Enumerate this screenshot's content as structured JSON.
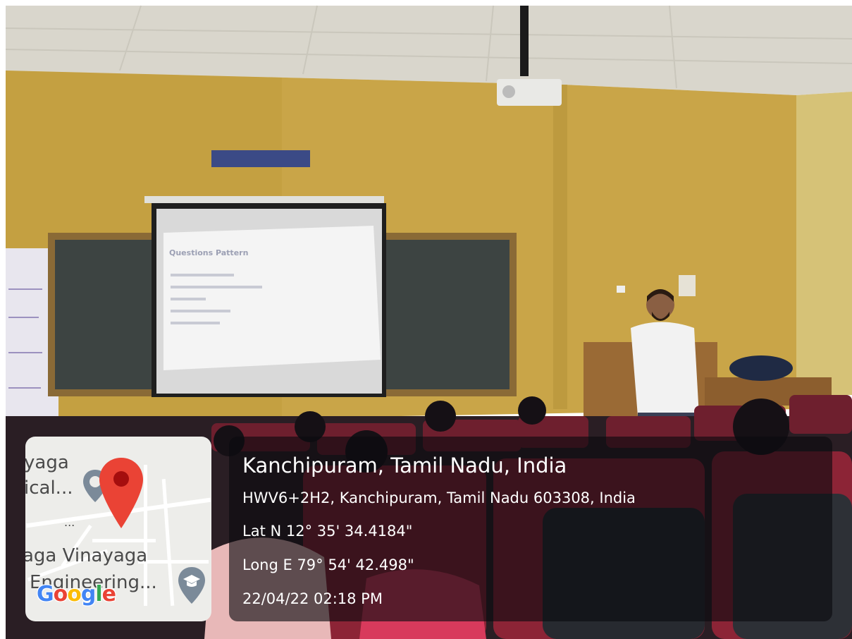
{
  "photo": {
    "slide_title": "Questions Pattern"
  },
  "map": {
    "label_top_1": "yaga",
    "label_top_2": "ical...",
    "label_ellipsis": "...",
    "label_bottom_1": "aga Vinayaga",
    "label_bottom_2": "Engineering...",
    "logo_text": "Google",
    "pin_color": "#ea4335",
    "poi_pin_color": "#7b8a99"
  },
  "location": {
    "title": "Kanchipuram, Tamil Nadu, India",
    "address": "HWV6+2H2, Kanchipuram, Tamil Nadu 603308, India",
    "latitude": "Lat N 12° 35' 34.4184\"",
    "longitude": "Long E 79° 54' 42.498\"",
    "timestamp": "22/04/22 02:18 PM"
  }
}
